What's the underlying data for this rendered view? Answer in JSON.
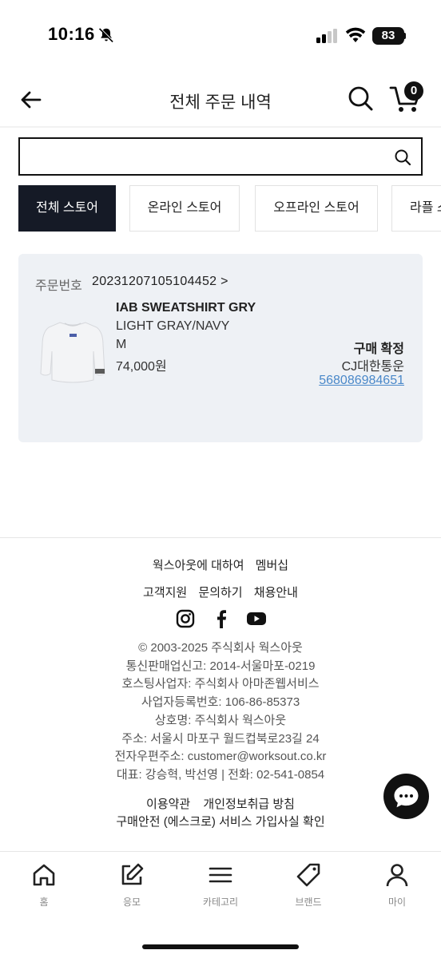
{
  "status_bar": {
    "time": "10:16",
    "battery": "83"
  },
  "header": {
    "title": "전체 주문 내역",
    "cart_count": "0"
  },
  "search": {
    "placeholder": "",
    "value": ""
  },
  "tabs": [
    {
      "label": "전체 스토어",
      "active": true
    },
    {
      "label": "온라인 스토어",
      "active": false
    },
    {
      "label": "오프라인 스토어",
      "active": false
    },
    {
      "label": "라플 스",
      "active": false
    }
  ],
  "order": {
    "number_label": "주문번호",
    "number": "20231207105104452 >",
    "product_name": "IAB SWEATSHIRT GRY",
    "color": "LIGHT GRAY/NAVY",
    "size": "M",
    "price": "74,000원",
    "status": "구매 확정",
    "courier": "CJ대한통운",
    "tracking_number": "568086984651"
  },
  "footer": {
    "links_row1": [
      "웍스아웃에 대하여",
      "멤버십"
    ],
    "links_row2": [
      "고객지원",
      "문의하기",
      "채용안내"
    ],
    "social_icons": [
      "instagram-icon",
      "facebook-icon",
      "youtube-icon"
    ],
    "company_info": [
      "© 2003-2025 주식회사 웍스아웃",
      "통신판매업신고: 2014-서울마포-0219",
      "호스팅사업자: 주식회사 아마존웹서비스",
      "사업자등록번호: 106-86-85373",
      "상호명: 주식회사 웍스아웃",
      "주소: 서울시 마포구 월드컵북로23길 24",
      "전자우편주소: customer@worksout.co.kr",
      "대표: 강승혁, 박선영 | 전화: 02-541-0854"
    ],
    "policy_row1": [
      "이용약관",
      "개인정보취급 방침"
    ],
    "policy_row2": "구매안전 (에스크로) 서비스 가입사실 확인"
  },
  "bottom_nav": [
    {
      "label": "홈",
      "icon": "home-icon"
    },
    {
      "label": "응모",
      "icon": "edit-icon"
    },
    {
      "label": "카테고리",
      "icon": "menu-icon"
    },
    {
      "label": "브랜드",
      "icon": "tag-icon"
    },
    {
      "label": "마이",
      "icon": "user-icon"
    }
  ],
  "colors": {
    "active_tab": "#151a26",
    "card_bg": "#eef1f5",
    "link": "#4a88c9"
  }
}
